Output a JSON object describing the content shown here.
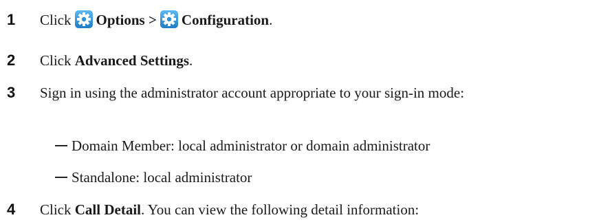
{
  "steps": [
    {
      "number": "1",
      "click_word": "Click",
      "options_label": "Options >",
      "configuration_label": "Configuration",
      "end": "."
    },
    {
      "number": "2",
      "click_word": "Click",
      "advanced_label": "Advanced Settings",
      "end": "."
    },
    {
      "number": "3",
      "text": "Sign in using the administrator account appropriate to your sign-in mode:"
    },
    {
      "number": "4",
      "click_word": "Click",
      "call_detail_label": "Call Detail",
      "rest": ". You can view the following detail information:"
    }
  ],
  "bullets": [
    {
      "dash": "—",
      "text": "Domain Member: local administrator or domain administrator"
    },
    {
      "dash": "—",
      "text": "Standalone: local administrator"
    }
  ],
  "icons": {
    "options": "gear-icon",
    "configuration": "gear-icon",
    "color": "#2a8fd6"
  }
}
